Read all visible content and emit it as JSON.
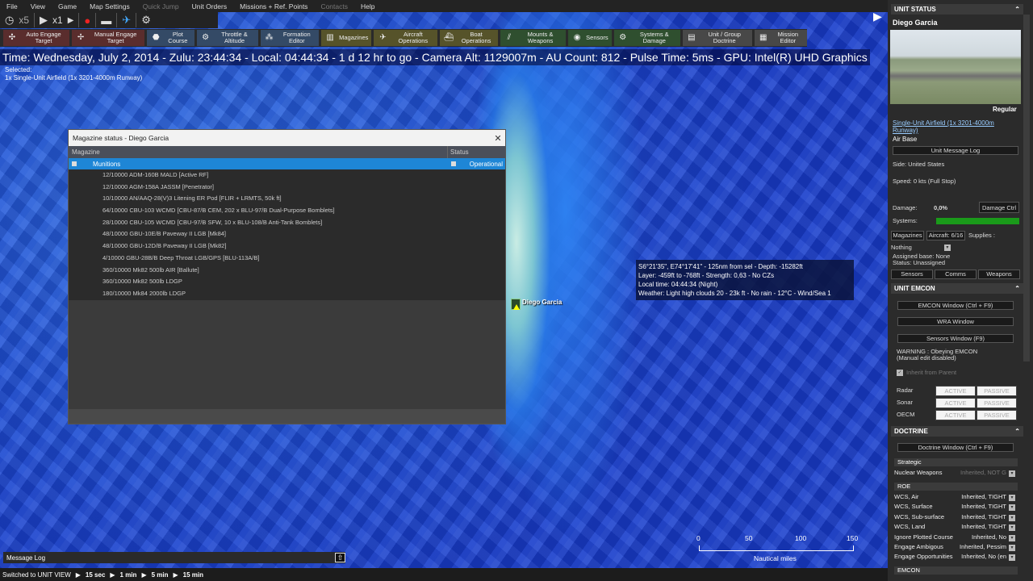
{
  "menu": {
    "items": [
      "File",
      "View",
      "Game",
      "Map Settings",
      "Quick Jump",
      "Unit Orders",
      "Missions + Ref. Points",
      "Contacts",
      "Help"
    ]
  },
  "timecontrols": {
    "speed1": "x5",
    "speed2": "x1"
  },
  "toolbar": [
    {
      "label": "Auto Engage Target",
      "color": "red",
      "icon": "crosshair-icon"
    },
    {
      "label": "Manual Engage Target",
      "color": "red",
      "icon": "target-icon"
    },
    {
      "label": "Plot Course",
      "color": "blue",
      "icon": "course-icon"
    },
    {
      "label": "Throttle & Altitude",
      "color": "blue",
      "icon": "throttle-icon"
    },
    {
      "label": "Formation Editor",
      "color": "blue",
      "icon": "formation-icon"
    },
    {
      "label": "Magazines",
      "color": "olive",
      "icon": "magazine-icon"
    },
    {
      "label": "Aircraft Operations",
      "color": "olive",
      "icon": "aircraft-icon"
    },
    {
      "label": "Boat Operations",
      "color": "olive",
      "icon": "boat-icon"
    },
    {
      "label": "Mounts & Weapons",
      "color": "green",
      "icon": "mounts-icon"
    },
    {
      "label": "Sensors",
      "color": "green",
      "icon": "sensor-icon"
    },
    {
      "label": "Systems & Damage",
      "color": "green",
      "icon": "gear-icon"
    },
    {
      "label": "Unit / Group Doctrine",
      "color": "gray",
      "icon": "doctrine-icon"
    },
    {
      "label": "Mission Editor",
      "color": "gray",
      "icon": "mission-icon"
    }
  ],
  "infoline": "Time: Wednesday, July 2, 2014 - Zulu: 23:44:34 - Local: 04:44:34 - 1 d 12 hr to go -  Camera Alt: 1129007m  - AU Count: 812 - Pulse Time: 5ms - GPU: Intel(R) UHD Graphics",
  "selected": {
    "label": "Selected:",
    "value": "1x Single-Unit Airfield (1x 3201-4000m Runway)"
  },
  "magazine": {
    "title": "Magazine status - Diego Garcia",
    "col_magazine": "Magazine",
    "col_status": "Status",
    "group": "Munitions",
    "group_status": "Operational",
    "rows": [
      "12/10000 ADM-160B MALD [Active RF]",
      "12/10000 AGM-158A JASSM [Penetrator]",
      "10/10000 AN/AAQ-28(V)3 Litening ER Pod [FLIR + LRMTS, 50k ft]",
      "64/10000 CBU-103 WCMD [CBU-87/B CEM, 202 x BLU-97/B Dual-Purpose Bomblets]",
      "28/10000 CBU-105 WCMD [CBU-97/B SFW, 10 x BLU-108/B Anti-Tank Bomblets]",
      "48/10000 GBU-10E/B Paveway II LGB [Mk84]",
      "48/10000 GBU-12D/B Paveway II LGB [Mk82]",
      "4/10000 GBU-28B/B Deep Throat LGB/GPS [BLU-113A/B]",
      "360/10000 Mk82 500lb AIR [Ballute]",
      "360/10000 Mk82 500lb LDGP",
      "180/10000 Mk84 2000lb LDGP"
    ]
  },
  "map_label": "Diego Garcia",
  "tooltip": [
    "S6°21'35\", E74°17'41\" - 125nm from sel - Depth: -15282ft",
    "Layer: -459ft to -768ft - Strength: 0,63 - No CZs",
    "Local time: 04:44:34 (Night)",
    "Weather: Light high clouds 20 - 23k ft - No rain - 12°C - Wind/Sea 1"
  ],
  "scale": {
    "ticks": [
      "0",
      "50",
      "100",
      "150"
    ],
    "unit": "Nautical miles"
  },
  "message_log": "Message Log",
  "statusbar": {
    "text": "Switched to UNIT VIEW",
    "steps": [
      "15 sec",
      "1 min",
      "5 min",
      "15 min"
    ]
  },
  "panel": {
    "unit_status": "UNIT STATUS",
    "name": "Diego Garcia",
    "proficiency": "Regular",
    "type": "Single-Unit Airfield (1x 3201-4000m Runway)",
    "category": "Air Base",
    "msglog_btn": "Unit Message Log",
    "side": "Side: United States",
    "speed": "Speed: 0 kts (Full Stop)",
    "damage_label": "Damage:",
    "damage_value": "0,0%",
    "damage_btn": "Damage Ctrl",
    "systems_label": "Systems:",
    "tab_magazines": "Magazines",
    "tab_aircraft": "Aircraft: 6/16",
    "tab_supplies": "Supplies :",
    "nothing": "Nothing",
    "assigned_base": "Assigned base: None",
    "unit_status_line": "Status: Unassigned",
    "btn_sensors": "Sensors",
    "btn_comms": "Comms",
    "btn_weapons": "Weapons",
    "emcon_header": "UNIT EMCON",
    "emcon_window": "EMCON Window (Ctrl + F9)",
    "wra_window": "WRA Window",
    "sensors_window": "Sensors Window (F9)",
    "warning1": "WARNING : Obeying EMCON",
    "warning2": "(Manual edit disabled)",
    "inherit": "Inherit from Parent",
    "emcon_rows": [
      {
        "label": "Radar"
      },
      {
        "label": "Sonar"
      },
      {
        "label": "OECM"
      }
    ],
    "active": "ACTIVE",
    "passive": "PASSIVE",
    "doctrine_header": "DOCTRINE",
    "doctrine_window": "Doctrine Window (Ctrl + F9)",
    "strategic": "Strategic",
    "nuclear": "Nuclear Weapons",
    "nuclear_val": "Inherited, NOT G",
    "roe": "ROE",
    "roe_rows": [
      {
        "k": "WCS, Air",
        "v": "Inherited, TIGHT"
      },
      {
        "k": "WCS, Surface",
        "v": "Inherited, TIGHT"
      },
      {
        "k": "WCS, Sub-surface",
        "v": "Inherited, TIGHT"
      },
      {
        "k": "WCS, Land",
        "v": "Inherited, TIGHT"
      },
      {
        "k": "Ignore Plotted Course",
        "v": "Inherited, No"
      },
      {
        "k": "Engage Ambigous",
        "v": "Inherited, Pessim"
      },
      {
        "k": "Engage Opportunities",
        "v": "Inherited, No (en"
      }
    ],
    "emcon2": "EMCON"
  }
}
